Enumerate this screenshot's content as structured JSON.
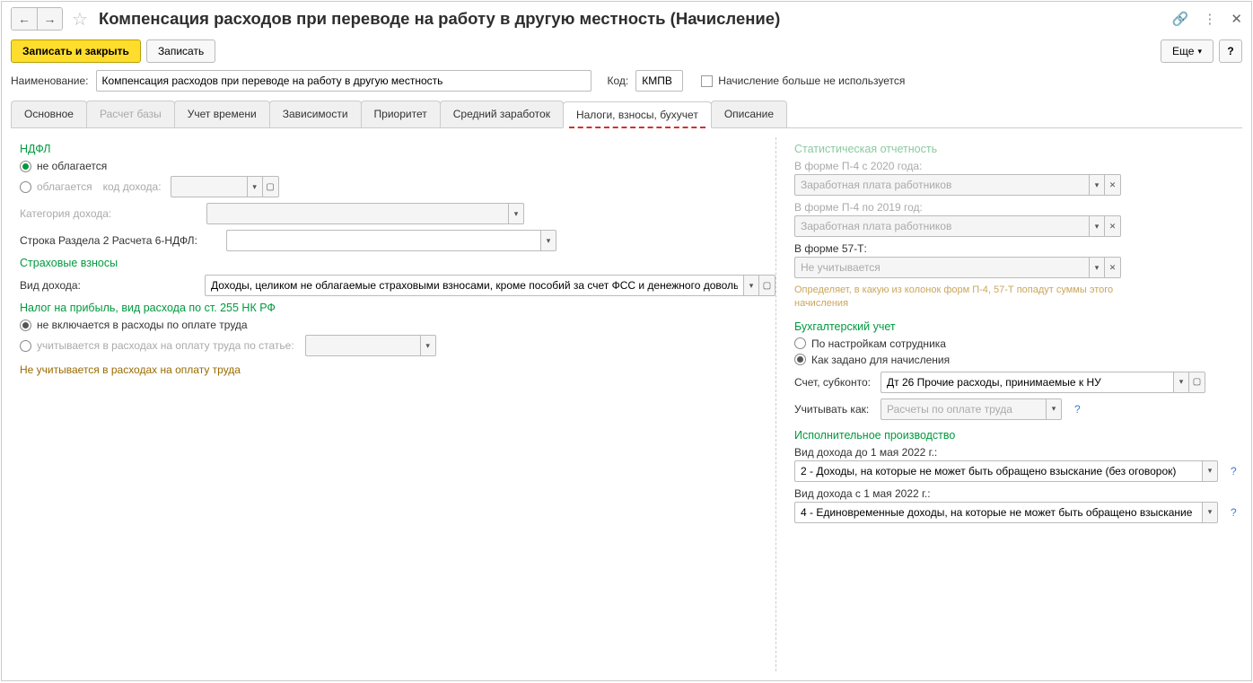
{
  "header": {
    "title": "Компенсация расходов при переводе на работу в другую местность (Начисление)"
  },
  "toolbar": {
    "save_close": "Записать и закрыть",
    "save": "Записать",
    "more": "Еще",
    "help": "?"
  },
  "form": {
    "name_label": "Наименование:",
    "name_value": "Компенсация расходов при переводе на работу в другую местность",
    "code_label": "Код:",
    "code_value": "КМПВ",
    "disabled_label": "Начисление больше не используется"
  },
  "tabs": [
    "Основное",
    "Расчет базы",
    "Учет времени",
    "Зависимости",
    "Приоритет",
    "Средний заработок",
    "Налоги, взносы, бухучет",
    "Описание"
  ],
  "ndfL": {
    "title": "НДФЛ",
    "not_taxed": "не облагается",
    "taxed": "облагается",
    "code_income": "код дохода:",
    "category": "Категория дохода:",
    "row6": "Строка Раздела 2 Расчета 6-НДФЛ:"
  },
  "ins": {
    "title": "Страховые взносы",
    "kind_label": "Вид дохода:",
    "kind_value": "Доходы, целиком не облагаемые страховыми взносами, кроме пособий за счет ФСС и денежного довольс"
  },
  "profit": {
    "title": "Налог на прибыль, вид расхода по ст. 255 НК РФ",
    "not_included": "не включается в расходы по оплате труда",
    "counted": "учитывается в расходах на оплату труда по статье:",
    "note": "Не учитывается в расходах на оплату труда"
  },
  "stat": {
    "title": "Статистическая отчетность",
    "p4_2020": "В форме П-4 с 2020 года:",
    "p4_2020_val": "Заработная плата работников",
    "p4_2019": "В форме П-4 по 2019 год:",
    "p4_2019_val": "Заработная плата работников",
    "f57": "В форме 57-Т:",
    "f57_val": "Не учитывается",
    "hint": "Определяет, в какую из колонок форм П-4, 57-Т попадут суммы этого начисления"
  },
  "acc": {
    "title": "Бухгалтерский учет",
    "by_employee": "По настройкам сотрудника",
    "as_set": "Как задано для начисления",
    "account_label": "Счет, субконто:",
    "account_value": "Дт 26 Прочие расходы, принимаемые к НУ",
    "consider_label": "Учитывать как:",
    "consider_value": "Расчеты по оплате труда"
  },
  "exec": {
    "title": "Исполнительное производство",
    "before_label": "Вид дохода до 1 мая 2022 г.:",
    "before_value": "2 - Доходы, на которые не может быть обращено взыскание (без оговорок)",
    "after_label": "Вид дохода с 1 мая 2022 г.:",
    "after_value": "4 - Единовременные доходы, на которые не может быть обращено взыскание"
  }
}
